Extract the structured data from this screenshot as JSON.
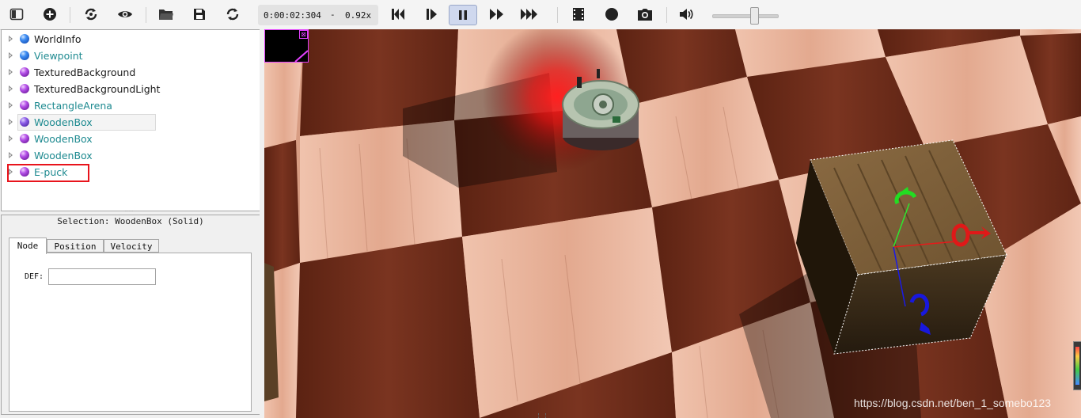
{
  "toolbar": {
    "time": "0:00:02:304",
    "separator": "-",
    "speed": "0.92x",
    "icons": [
      "scene-tree-toggle-icon",
      "add-node-icon",
      "reload-world-icon",
      "view-icon",
      "open-world-icon",
      "save-world-icon",
      "reset-simulation-icon",
      "step-back-icon",
      "step-icon",
      "pause-icon",
      "fast-forward-icon",
      "fastest-icon",
      "record-movie-icon",
      "record-animation-icon",
      "screenshot-icon",
      "sound-icon"
    ],
    "volume_level": 0.62
  },
  "scene_tree": {
    "items": [
      {
        "label": "WorldInfo",
        "ball": "blue",
        "style": "dark"
      },
      {
        "label": "Viewpoint",
        "ball": "blue",
        "style": "teal"
      },
      {
        "label": "TexturedBackground",
        "ball": "purple",
        "style": "dark"
      },
      {
        "label": "TexturedBackgroundLight",
        "ball": "purple",
        "style": "dark"
      },
      {
        "label": "RectangleArena",
        "ball": "purple",
        "style": "teal"
      },
      {
        "label": "WoodenBox",
        "ball": "violet",
        "style": "teal",
        "selected": true
      },
      {
        "label": "WoodenBox",
        "ball": "purple",
        "style": "teal"
      },
      {
        "label": "WoodenBox",
        "ball": "purple",
        "style": "teal"
      },
      {
        "label": "E-puck",
        "ball": "purple",
        "style": "teal",
        "highlighted": true
      }
    ]
  },
  "field_editor": {
    "selection_title": "Selection: WoodenBox (Solid)",
    "tabs": [
      "Node",
      "Position",
      "Velocity"
    ],
    "active_tab": "Node",
    "def_label": "DEF:",
    "def_value": ""
  },
  "view3d": {
    "watermark": "https://blog.csdn.net/ben_1_somebo123",
    "overlay_close": "⊠"
  },
  "colors": {
    "tree_teal": "#1e8a90",
    "highlight_red": "#e8141c",
    "floor_dark": "#6b2a17",
    "floor_light": "#e9b49d"
  }
}
